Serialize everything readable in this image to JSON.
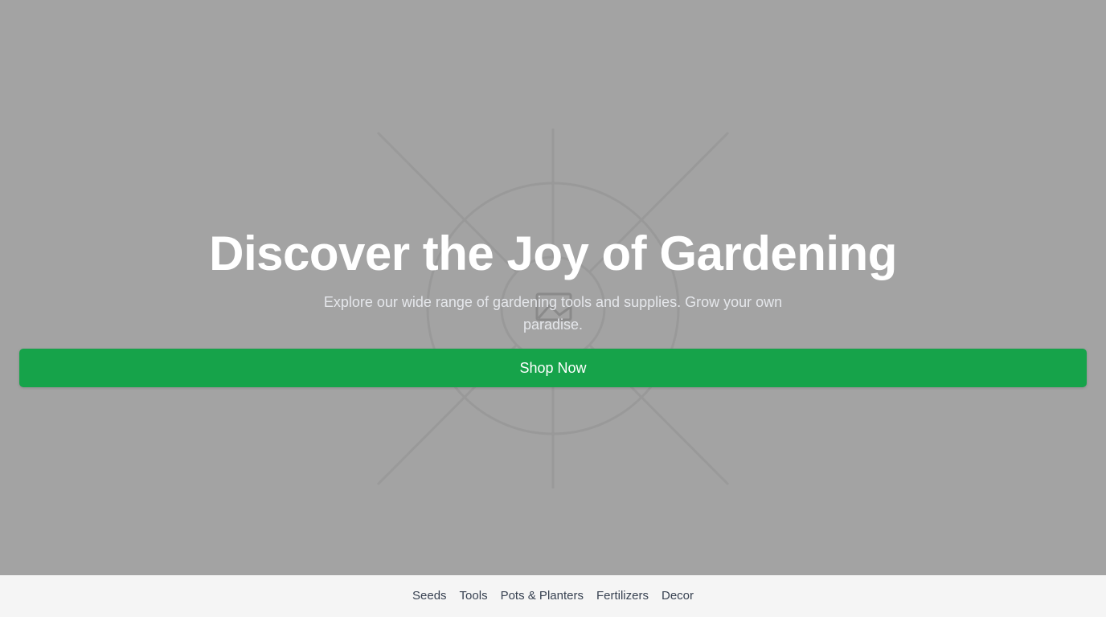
{
  "hero": {
    "title": "Discover the Joy of Gardening",
    "subtitle": "Explore our wide range of gardening tools and supplies. Grow your own paradise.",
    "cta_label": "Shop Now",
    "background_color": "#a3a3a3",
    "background_image_icon": "image-placeholder-icon"
  },
  "colors": {
    "accent": "#16a34a",
    "footer_bg": "#f5f5f5",
    "text_dark": "#374151"
  },
  "nav": {
    "items": [
      {
        "label": "Seeds"
      },
      {
        "label": "Tools"
      },
      {
        "label": "Pots & Planters"
      },
      {
        "label": "Fertilizers"
      },
      {
        "label": "Decor"
      }
    ]
  }
}
